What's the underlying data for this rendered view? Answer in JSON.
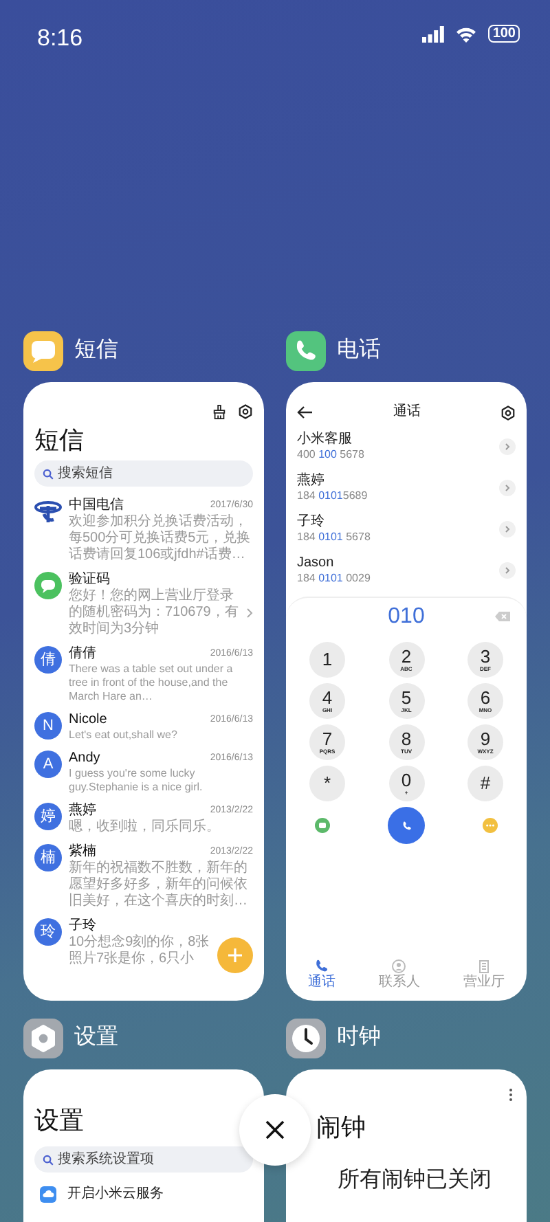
{
  "status_bar": {
    "time": "8:16",
    "battery": "100"
  },
  "apps": [
    {
      "kind": "messages",
      "label": "短信",
      "screen": {
        "title": "短信",
        "search_placeholder": "搜索短信",
        "threads": [
          {
            "kind": "carrier",
            "sender": "中国电信",
            "date": "2017/6/30",
            "preview": "欢迎参加积分兑换话费活动，每500分可兑换话费5元，兑换话费请回复106或jfdh#话费…"
          },
          {
            "kind": "chat",
            "sender": "验证码",
            "preview": "您好！您的网上营业厅登录的随机密码为：710679，有效时间为3分钟",
            "chevron": true
          },
          {
            "kind": "letter",
            "avatar": "倩",
            "sender": "倩倩",
            "date": "2016/6/13",
            "preview": "There was a table set out under a tree in front of the house,and the March Hare an…"
          },
          {
            "kind": "letter",
            "avatar": "N",
            "sender": "Nicole",
            "date": "2016/6/13",
            "preview": "Let's eat out,shall we?"
          },
          {
            "kind": "letter",
            "avatar": "A",
            "sender": "Andy",
            "date": "2016/6/13",
            "preview": "I guess you're some lucky guy.Stephanie is a nice girl."
          },
          {
            "kind": "letter",
            "avatar": "婷",
            "sender": "燕婷",
            "date": "2013/2/22",
            "preview": "嗯，收到啦，同乐同乐。"
          },
          {
            "kind": "letter",
            "avatar": "楠",
            "sender": "紫楠",
            "date": "2013/2/22",
            "preview": "新年的祝福数不胜数，新年的愿望好多好多，新年的问候依旧美好，在这个喜庆的时刻…"
          },
          {
            "kind": "letter",
            "avatar": "玲",
            "sender": "子玲",
            "preview": "10分想念9刻的你，8张照片7张是你，6只小"
          }
        ]
      }
    },
    {
      "kind": "phone",
      "label": "电话",
      "screen": {
        "title": "通话",
        "contacts": [
          {
            "name": "小米客服",
            "number": [
              {
                "text": "400 ",
                "match": false
              },
              {
                "text": "100",
                "match": true
              },
              {
                "text": " 5678",
                "match": false
              }
            ]
          },
          {
            "name": "燕婷",
            "number": [
              {
                "text": "184 ",
                "match": false
              },
              {
                "text": "0101",
                "match": true
              },
              {
                "text": "5689",
                "match": false
              }
            ]
          },
          {
            "name": "子玲",
            "number": [
              {
                "text": "184 ",
                "match": false
              },
              {
                "text": "0101",
                "match": true
              },
              {
                "text": " 5678",
                "match": false
              }
            ]
          },
          {
            "name": "Jason",
            "number": [
              {
                "text": "184 ",
                "match": false
              },
              {
                "text": "0101",
                "match": true
              },
              {
                "text": " 0029",
                "match": false
              }
            ]
          }
        ],
        "dialed": "010",
        "keys": [
          {
            "digit": "1"
          },
          {
            "digit": "2",
            "letters": "ABC"
          },
          {
            "digit": "3",
            "letters": "DEF"
          },
          {
            "digit": "4",
            "letters": "GHI"
          },
          {
            "digit": "5",
            "letters": "JKL"
          },
          {
            "digit": "6",
            "letters": "MNO"
          },
          {
            "digit": "7",
            "letters": "PQRS"
          },
          {
            "digit": "8",
            "letters": "TUV"
          },
          {
            "digit": "9",
            "letters": "WXYZ"
          },
          {
            "digit": "*"
          },
          {
            "digit": "0",
            "letters": "+"
          },
          {
            "digit": "#"
          }
        ],
        "tabs": [
          {
            "kind": "calls",
            "label": "通话",
            "selected": true
          },
          {
            "kind": "contacts",
            "label": "联系人",
            "selected": false
          },
          {
            "kind": "hall",
            "label": "营业厅",
            "selected": false
          }
        ]
      }
    },
    {
      "kind": "settings",
      "label": "设置",
      "screen": {
        "title": "设置",
        "search_placeholder": "搜索系统设置项",
        "items": [
          {
            "label": "开启小米云服务"
          }
        ]
      }
    },
    {
      "kind": "clock",
      "label": "时钟",
      "screen": {
        "title": "闹钟",
        "empty_message": "所有闹钟已关闭"
      }
    }
  ]
}
